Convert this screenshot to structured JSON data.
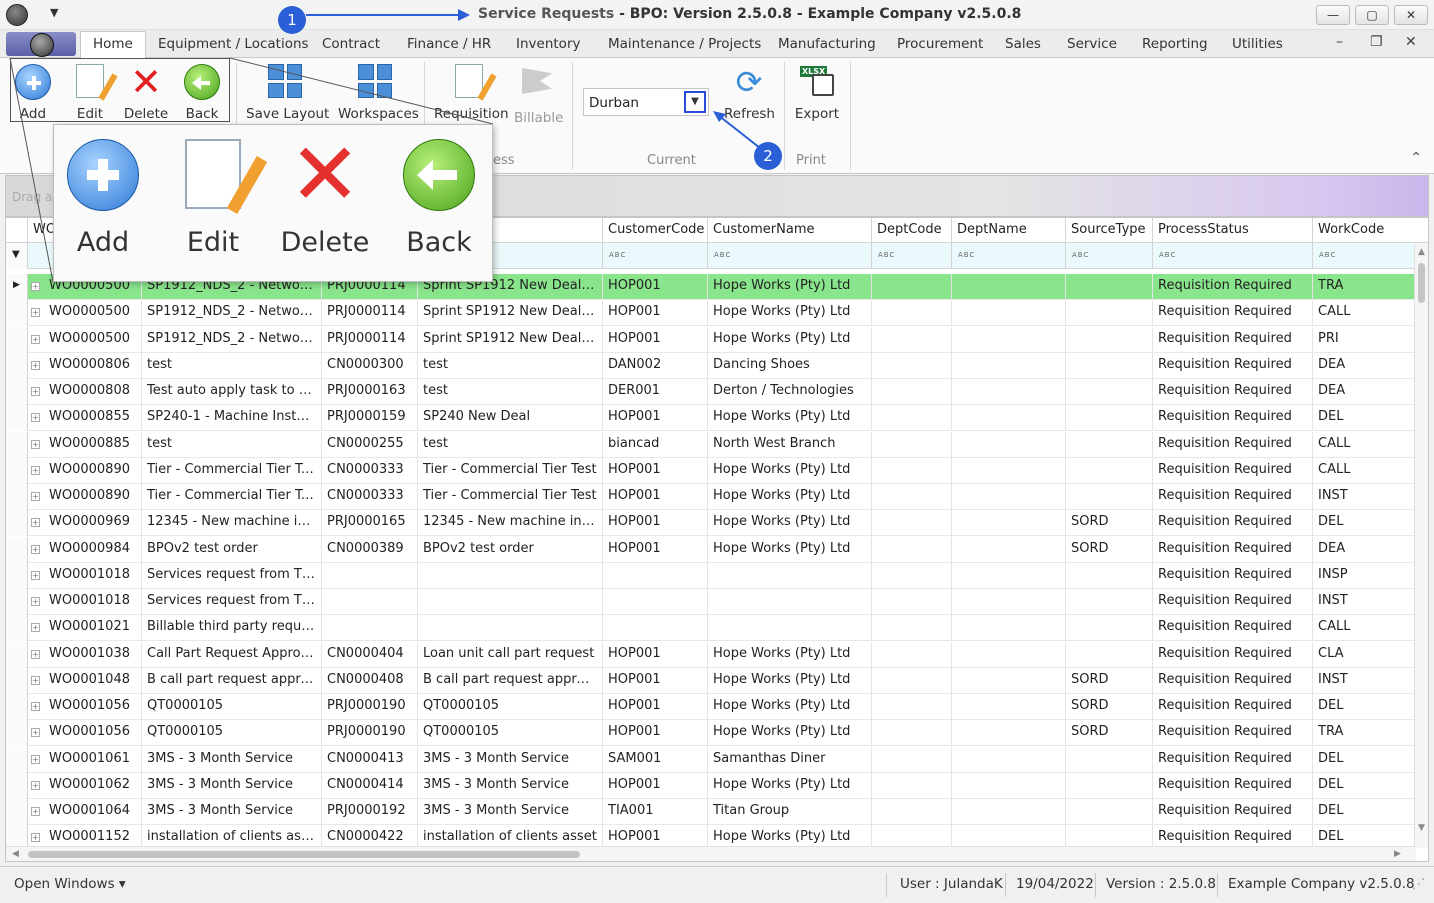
{
  "titlebar": {
    "app_name": "Service Requests",
    "title_rest": " - BPO: Version 2.5.0.8 - Example Company v2.5.0.8",
    "minimize": "—",
    "maximize": "▢",
    "close": "✕"
  },
  "menu": {
    "tabs": [
      "Home",
      "Equipment / Locations",
      "Contract",
      "Finance / HR",
      "Inventory",
      "Maintenance / Projects",
      "Manufacturing",
      "Procurement",
      "Sales",
      "Service",
      "Reporting",
      "Utilities"
    ],
    "active_tab": "Home"
  },
  "ribbon": {
    "add": "Add",
    "edit": "Edit",
    "delete": "Delete",
    "back": "Back",
    "save_layout": "Save Layout",
    "workspaces": "Workspaces",
    "requisition": "Requisition",
    "billable": "Billable",
    "process_group": "ess",
    "site_value": "Durban",
    "refresh": "Refresh",
    "current_group": "Current",
    "export": "Export",
    "print_group": "Print",
    "xlsx_tag": "XLSX"
  },
  "grid": {
    "drag_hint": "Drag a",
    "columns": [
      "WO",
      "",
      "",
      "",
      "CustomerCode",
      "CustomerName",
      "DeptCode",
      "DeptName",
      "SourceType",
      "ProcessStatus",
      "WorkCode"
    ],
    "filter_placeholder": "ABC",
    "rows": [
      [
        "WO0000500",
        "SP1912_NDS_2 - Network ...",
        "PRJ0000114",
        "Sprint SP1912 New Deal Sale",
        "HOP001",
        "Hope Works (Pty) Ltd",
        "",
        "",
        "",
        "Requisition Required",
        "TRA"
      ],
      [
        "WO0000500",
        "SP1912_NDS_2 - Network ...",
        "PRJ0000114",
        "Sprint SP1912 New Deal Sale",
        "HOP001",
        "Hope Works (Pty) Ltd",
        "",
        "",
        "",
        "Requisition Required",
        "CALL"
      ],
      [
        "WO0000500",
        "SP1912_NDS_2 - Network ...",
        "PRJ0000114",
        "Sprint SP1912 New Deal Sale",
        "HOP001",
        "Hope Works (Pty) Ltd",
        "",
        "",
        "",
        "Requisition Required",
        "PRI"
      ],
      [
        "WO0000806",
        "test",
        "CN0000300",
        "test",
        "DAN002",
        "Dancing Shoes",
        "",
        "",
        "",
        "Requisition Required",
        "DEA"
      ],
      [
        "WO0000808",
        "Test auto apply task to st...",
        "PRJ0000163",
        "test",
        "DER001",
        "Derton / Technologies",
        "",
        "",
        "",
        "Requisition Required",
        "DEA"
      ],
      [
        "WO0000855",
        "SP240-1 - Machine Installa...",
        "PRJ0000159",
        "SP240 New Deal",
        "HOP001",
        "Hope Works (Pty) Ltd",
        "",
        "",
        "",
        "Requisition Required",
        "DEL"
      ],
      [
        "WO0000885",
        "test",
        "CN0000255",
        "test",
        "biancad",
        "North West Branch",
        "",
        "",
        "",
        "Requisition Required",
        "CALL"
      ],
      [
        "WO0000890",
        "Tier - Commercial Tier Test",
        "CN0000333",
        "Tier - Commercial Tier Test",
        "HOP001",
        "Hope Works (Pty) Ltd",
        "",
        "",
        "",
        "Requisition Required",
        "CALL"
      ],
      [
        "WO0000890",
        "Tier - Commercial Tier Test",
        "CN0000333",
        "Tier - Commercial Tier Test",
        "HOP001",
        "Hope Works (Pty) Ltd",
        "",
        "",
        "",
        "Requisition Required",
        "INST"
      ],
      [
        "WO0000969",
        "12345 - New machine inst...",
        "PRJ0000165",
        "12345 - New machine instal...",
        "HOP001",
        "Hope Works (Pty) Ltd",
        "",
        "",
        "SORD",
        "Requisition Required",
        "DEL"
      ],
      [
        "WO0000984",
        "BPOv2 test order",
        "CN0000389",
        "BPOv2 test order",
        "HOP001",
        "Hope Works (Pty) Ltd",
        "",
        "",
        "SORD",
        "Requisition Required",
        "DEA"
      ],
      [
        "WO0001018",
        "Services request from Thir...",
        "",
        "",
        "",
        "",
        "",
        "",
        "",
        "Requisition Required",
        "INSP"
      ],
      [
        "WO0001018",
        "Services request from Thir...",
        "",
        "",
        "",
        "",
        "",
        "",
        "",
        "Requisition Required",
        "INST"
      ],
      [
        "WO0001021",
        "Billable third party request...",
        "",
        "",
        "",
        "",
        "",
        "",
        "",
        "Requisition Required",
        "CALL"
      ],
      [
        "WO0001038",
        " Call Part Request Approval",
        "CN0000404",
        "Loan unit call part request",
        "HOP001",
        "Hope Works (Pty) Ltd",
        "",
        "",
        "",
        "Requisition Required",
        "CLA"
      ],
      [
        "WO0001048",
        "B call part request approval",
        "CN0000408",
        "B call part request approval",
        "HOP001",
        "Hope Works (Pty) Ltd",
        "",
        "",
        "SORD",
        "Requisition Required",
        "INST"
      ],
      [
        "WO0001056",
        "QT0000105",
        "PRJ0000190",
        "QT0000105",
        "HOP001",
        "Hope Works (Pty) Ltd",
        "",
        "",
        "SORD",
        "Requisition Required",
        "DEL"
      ],
      [
        "WO0001056",
        "QT0000105",
        "PRJ0000190",
        "QT0000105",
        "HOP001",
        "Hope Works (Pty) Ltd",
        "",
        "",
        "SORD",
        "Requisition Required",
        "TRA"
      ],
      [
        "WO0001061",
        "3MS - 3 Month Service",
        "CN0000413",
        "3MS - 3 Month Service",
        "SAM001",
        "Samanthas Diner",
        "",
        "",
        "",
        "Requisition Required",
        "DEL"
      ],
      [
        "WO0001062",
        "3MS - 3 Month Service",
        "CN0000414",
        "3MS - 3 Month Service",
        "HOP001",
        "Hope Works (Pty) Ltd",
        "",
        "",
        "",
        "Requisition Required",
        "DEL"
      ],
      [
        "WO0001064",
        "3MS - 3 Month Service",
        "PRJ0000192",
        "3MS - 3 Month Service",
        "TIA001",
        "Titan Group",
        "",
        "",
        "",
        "Requisition Required",
        "DEL"
      ],
      [
        "WO0001152",
        "installation of clients asset",
        "CN0000422",
        "installation of clients asset",
        "HOP001",
        "Hope Works (Pty) Ltd",
        "",
        "",
        "",
        "Requisition Required",
        "DEL"
      ]
    ],
    "selected_row": 0,
    "selected_color": "#89e58b"
  },
  "statusbar": {
    "open_windows": "Open Windows ▾",
    "user": "User : JulandaK",
    "date": "19/04/2022",
    "version": "Version : 2.5.0.8",
    "company": "Example Company v2.5.0.8"
  },
  "zoom": {
    "add": "Add",
    "edit": "Edit",
    "delete": "Delete",
    "back": "Back"
  },
  "annotations": {
    "badge1": "1",
    "badge2": "2",
    "color": "#2a5fd8"
  }
}
